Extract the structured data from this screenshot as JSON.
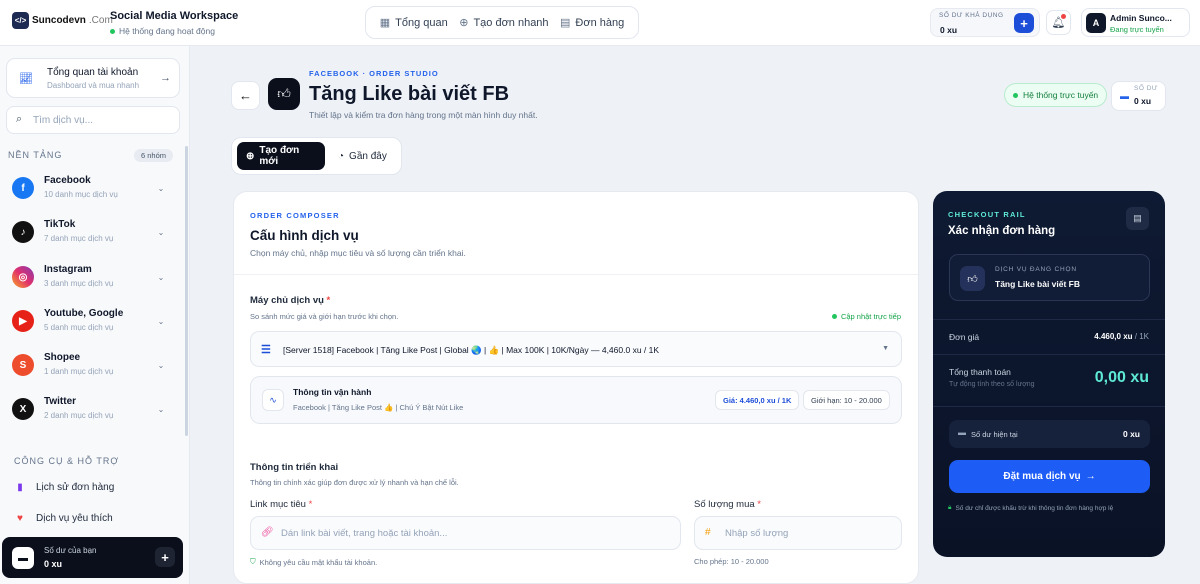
{
  "brand": {
    "logo_text": "Suncodevn",
    "logo_suffix": ".Com",
    "logo_mark": "</>"
  },
  "workspace": {
    "title": "Social Media Workspace",
    "status": "Hệ thống đang hoạt động"
  },
  "topnav": [
    {
      "label": "Tổng quan",
      "icon": "grid-icon"
    },
    {
      "label": "Tạo đơn nhanh",
      "icon": "plus-circle-icon"
    },
    {
      "label": "Đơn hàng",
      "icon": "receipt-icon"
    }
  ],
  "top_balance": {
    "label": "SỐ DƯ KHẢ DỤNG",
    "value": "0 xu",
    "add": "+"
  },
  "user": {
    "initial": "A",
    "name": "Admin Sunco...",
    "status": "Đang trực tuyến"
  },
  "sidebar": {
    "overview": {
      "title": "Tổng quan tài khoản",
      "subtitle": "Dashboard và mua nhanh"
    },
    "search_placeholder": "Tìm dịch vụ...",
    "platform_heading": "NỀN TẢNG",
    "platform_count": "6 nhóm",
    "platforms": [
      {
        "name": "Facebook",
        "sub": "10 danh mục dịch vụ",
        "color": "#1877f2",
        "glyph": "f"
      },
      {
        "name": "TikTok",
        "sub": "7 danh mục dịch vụ",
        "color": "#111111",
        "glyph": "♪"
      },
      {
        "name": "Instagram",
        "sub": "3 danh mục dịch vụ",
        "color": "#e1306c",
        "glyph": "◎"
      },
      {
        "name": "Youtube, Google",
        "sub": "5 danh mục dịch vụ",
        "color": "#e62117",
        "glyph": "▶"
      },
      {
        "name": "Shopee",
        "sub": "1 danh mục dịch vụ",
        "color": "#ee4d2d",
        "glyph": "S"
      },
      {
        "name": "Twitter",
        "sub": "2 danh mục dịch vụ",
        "color": "#111111",
        "glyph": "X"
      }
    ],
    "tools_heading": "CÔNG CỤ & HỖ TRỢ",
    "tools": [
      {
        "label": "Lịch sử đơn hàng",
        "icon": "history-icon",
        "glyph": "▮",
        "color": "#7c3aed"
      },
      {
        "label": "Dịch vụ yêu thích",
        "icon": "heart-icon",
        "glyph": "♥",
        "color": "#ef4444"
      }
    ],
    "balance": {
      "label": "Số dư của bạn",
      "value": "0 xu",
      "add": "+"
    }
  },
  "page": {
    "breadcrumb": "FACEBOOK  ·  ORDER STUDIO",
    "title": "Tăng Like bài viết FB",
    "subtitle": "Thiết lập và kiểm tra đơn hàng trong một màn hình duy nhất.",
    "online": "Hệ thống trực tuyến",
    "balance_label": "SỐ DƯ",
    "balance_value": "0 xu",
    "tabs": [
      {
        "label": "Tạo đơn mới"
      },
      {
        "label": "Gần đây"
      }
    ]
  },
  "composer": {
    "kicker": "ORDER COMPOSER",
    "title": "Cấu hình dịch vụ",
    "subtitle": "Chọn máy chủ, nhập mục tiêu và số lượng cần triển khai.",
    "server_label": "Máy chủ dịch vụ",
    "server_hint": "So sánh mức giá và giới hạn trước khi chọn.",
    "live_label": "Cập nhật trực tiếp",
    "server_selected": "[Server 1518] Facebook | Tăng Like Post | Global 🌏 | 👍 | Max 100K | 10K/Ngày — 4,460.0 xu / 1K",
    "info_title": "Thông tin vận hành",
    "info_sub": "Facebook | Tăng Like Post 👍 | Chú Ý Bật Nút Like",
    "price_chip": "Giá: 4.460,0 xu / 1K",
    "limit_chip": "Giới hạn: 10 - 20.000",
    "deploy_title": "Thông tin triển khai",
    "deploy_sub": "Thông tin chính xác giúp đơn được xử lý nhanh và hạn chế lỗi.",
    "link_label": "Link mục tiêu",
    "link_placeholder": "Dán link bài viết, trang hoặc tài khoản...",
    "link_hint": "Không yêu cầu mật khẩu tài khoản.",
    "qty_label": "Số lượng mua",
    "qty_placeholder": "Nhập số lượng",
    "qty_hint": "Cho phép: 10 - 20.000",
    "required_mark": "*"
  },
  "checkout": {
    "kicker": "CHECKOUT RAIL",
    "title": "Xác nhận đơn hàng",
    "svc_label": "DỊCH VỤ ĐANG CHỌN",
    "svc_value": "Tăng Like bài viết FB",
    "unit_label": "Đơn giá",
    "unit_value": "4.460,0 xu",
    "unit_suffix": "/ 1K",
    "total_label": "Tổng thanh toán",
    "total_sub": "Tự động tính theo số lượng",
    "total_value": "0,00 xu",
    "current_label": "Số dư hiện tại",
    "current_value": "0 xu",
    "button": "Đặt mua dịch vụ",
    "note": "Số dư chỉ được khấu trừ khi thông tin đơn hàng hợp lệ"
  }
}
